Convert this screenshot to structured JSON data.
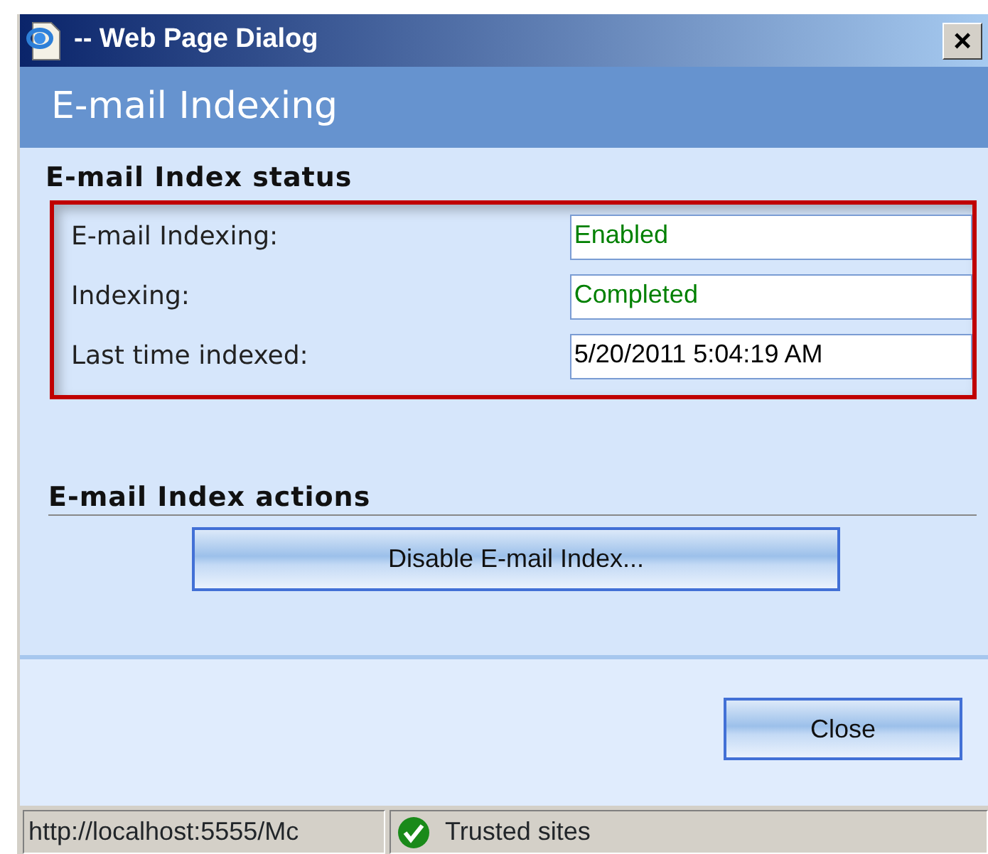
{
  "window": {
    "title": "-- Web Page Dialog",
    "close": "×"
  },
  "header": "E-mail Indexing",
  "status": {
    "heading": "E-mail Index status",
    "highlighted": true,
    "fields": [
      {
        "label": "E-mail Indexing:",
        "value": "Enabled",
        "color": "#008000"
      },
      {
        "label": "Indexing:",
        "value": "Completed",
        "color": "#008000"
      },
      {
        "label": "Last time indexed:",
        "value": "5/20/2011 5:04:19 AM",
        "color": "#000000"
      }
    ]
  },
  "actions": {
    "heading": "E-mail Index actions",
    "buttons": [
      "Disable E-mail Index..."
    ]
  },
  "footer_buttons": [
    "Close"
  ],
  "status_bar": {
    "url": "http://localhost:5555/Mc",
    "zone": "Trusted sites"
  }
}
